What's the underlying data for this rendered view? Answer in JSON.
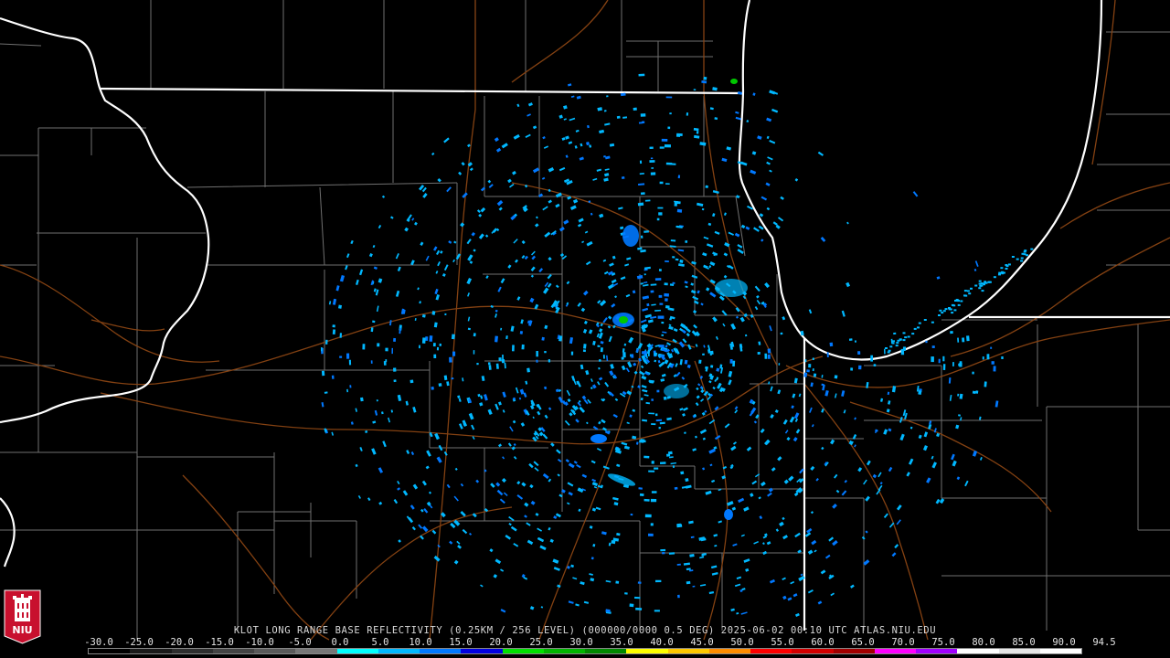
{
  "caption": "KLOT LONG RANGE BASE REFLECTIVITY (0.25KM / 256 LEVEL) (000000/0000 0.5 DEG) 2025-06-02 00:10 UTC  ATLAS.NIU.EDU",
  "logo": {
    "text": "NIU",
    "icon": "niu-tower-icon"
  },
  "colorbar": {
    "labels": [
      "-30.0",
      "-25.0",
      "-20.0",
      "-15.0",
      "-10.0",
      "-5.0",
      "0.0",
      "5.0",
      "10.0",
      "15.0",
      "20.0",
      "25.0",
      "30.0",
      "35.0",
      "40.0",
      "45.0",
      "50.0",
      "55.0",
      "60.0",
      "65.0",
      "70.0",
      "75.0",
      "80.0",
      "85.0",
      "90.0",
      "94.5"
    ],
    "colors": [
      "#000000",
      "#1a1a1a",
      "#2e2e2e",
      "#444444",
      "#5a5a5a",
      "#777777",
      "#00ffff",
      "#00b8ff",
      "#0078ff",
      "#0000e0",
      "#00e000",
      "#00b400",
      "#008800",
      "#ffff00",
      "#ffc800",
      "#ff8c00",
      "#ff0000",
      "#d20000",
      "#a00000",
      "#ff00ff",
      "#a000ff",
      "#ffffff",
      "#e6e6e6",
      "#ffffff"
    ]
  },
  "map": {
    "radar_site": "KLOT",
    "colors": {
      "state_lines": "#ffffff",
      "county_lines": "#8c8c8c",
      "roads": "#8b4513",
      "echo_weak": "#00b8ff",
      "echo_mid": "#0078ff",
      "echo_strong": "#00c800"
    }
  }
}
